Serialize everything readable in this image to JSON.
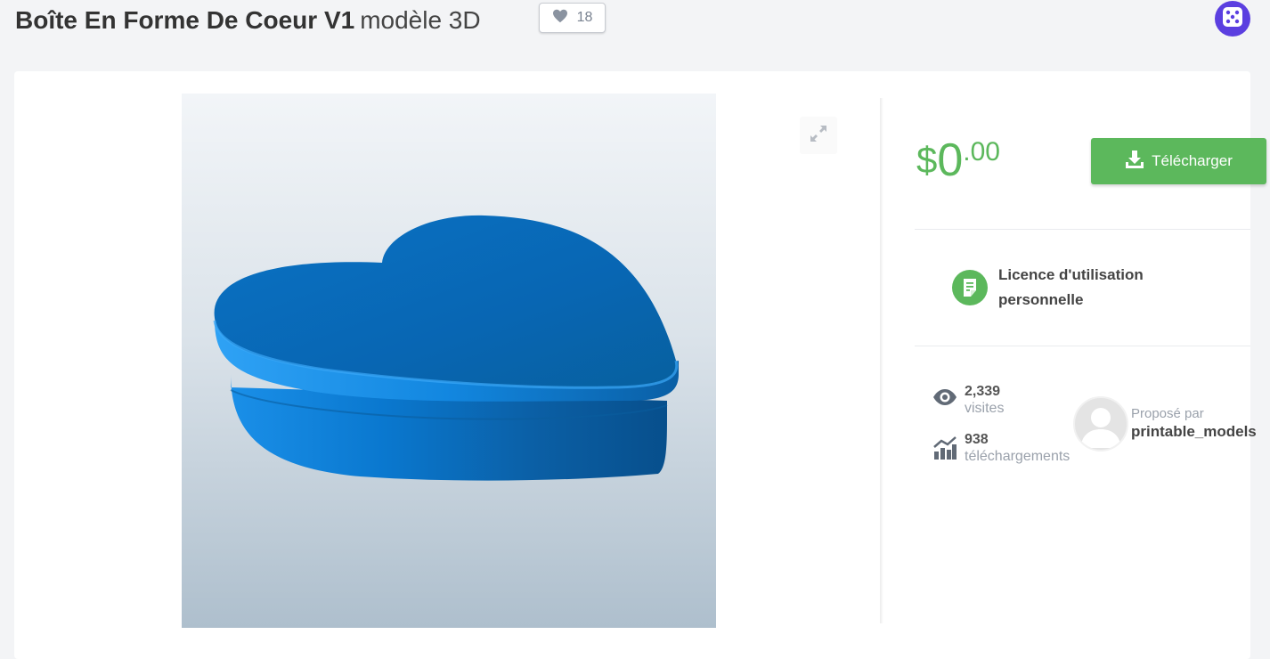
{
  "header": {
    "title_bold": "Boîte En Forme De Coeur V1",
    "title_sub": "modèle 3D",
    "likes": "18",
    "icons": {
      "like": "heart-icon",
      "random": "dice-icon"
    }
  },
  "viewer": {
    "expand_icon": "expand-icon",
    "model_color": "#0a73c8"
  },
  "purchase": {
    "currency": "$",
    "price_int": "0",
    "price_dec": ".00",
    "download_label": "Télécharger",
    "download_icon": "download-icon"
  },
  "license": {
    "line1": "Licence d'utilisation",
    "line2": "personnelle",
    "icon": "document-icon"
  },
  "stats": {
    "views_value": "2,339",
    "views_label": "visites",
    "downloads_value": "938",
    "downloads_label": "téléchargements"
  },
  "author": {
    "proposed_label": "Proposé par",
    "username": "printable_models"
  },
  "colors": {
    "accent_green": "#5cb85c",
    "dice_purple": "#5b3fe0",
    "page_bg": "#f3f4f6"
  }
}
